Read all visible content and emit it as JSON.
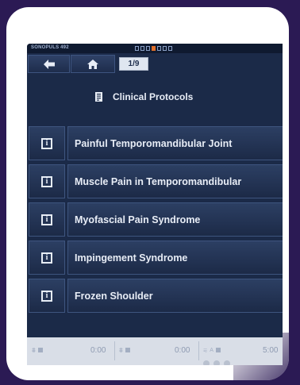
{
  "device": {
    "model": "SONOPULS 492"
  },
  "nav": {
    "page": "1/9"
  },
  "header": {
    "title": "Clinical Protocols"
  },
  "protocols": [
    "Painful Temporomandibular Joint",
    "Muscle Pain in Temporomandibular",
    "Myofascial Pain Syndrome",
    "Impingement Syndrome",
    "Frozen Shoulder"
  ],
  "bottom": {
    "time1": "0:00",
    "time2": "0:00",
    "time3": "5:00",
    "label3": "A"
  },
  "colors": {
    "screen_bg": "#1b2a48",
    "status_active": "#e2702b"
  }
}
